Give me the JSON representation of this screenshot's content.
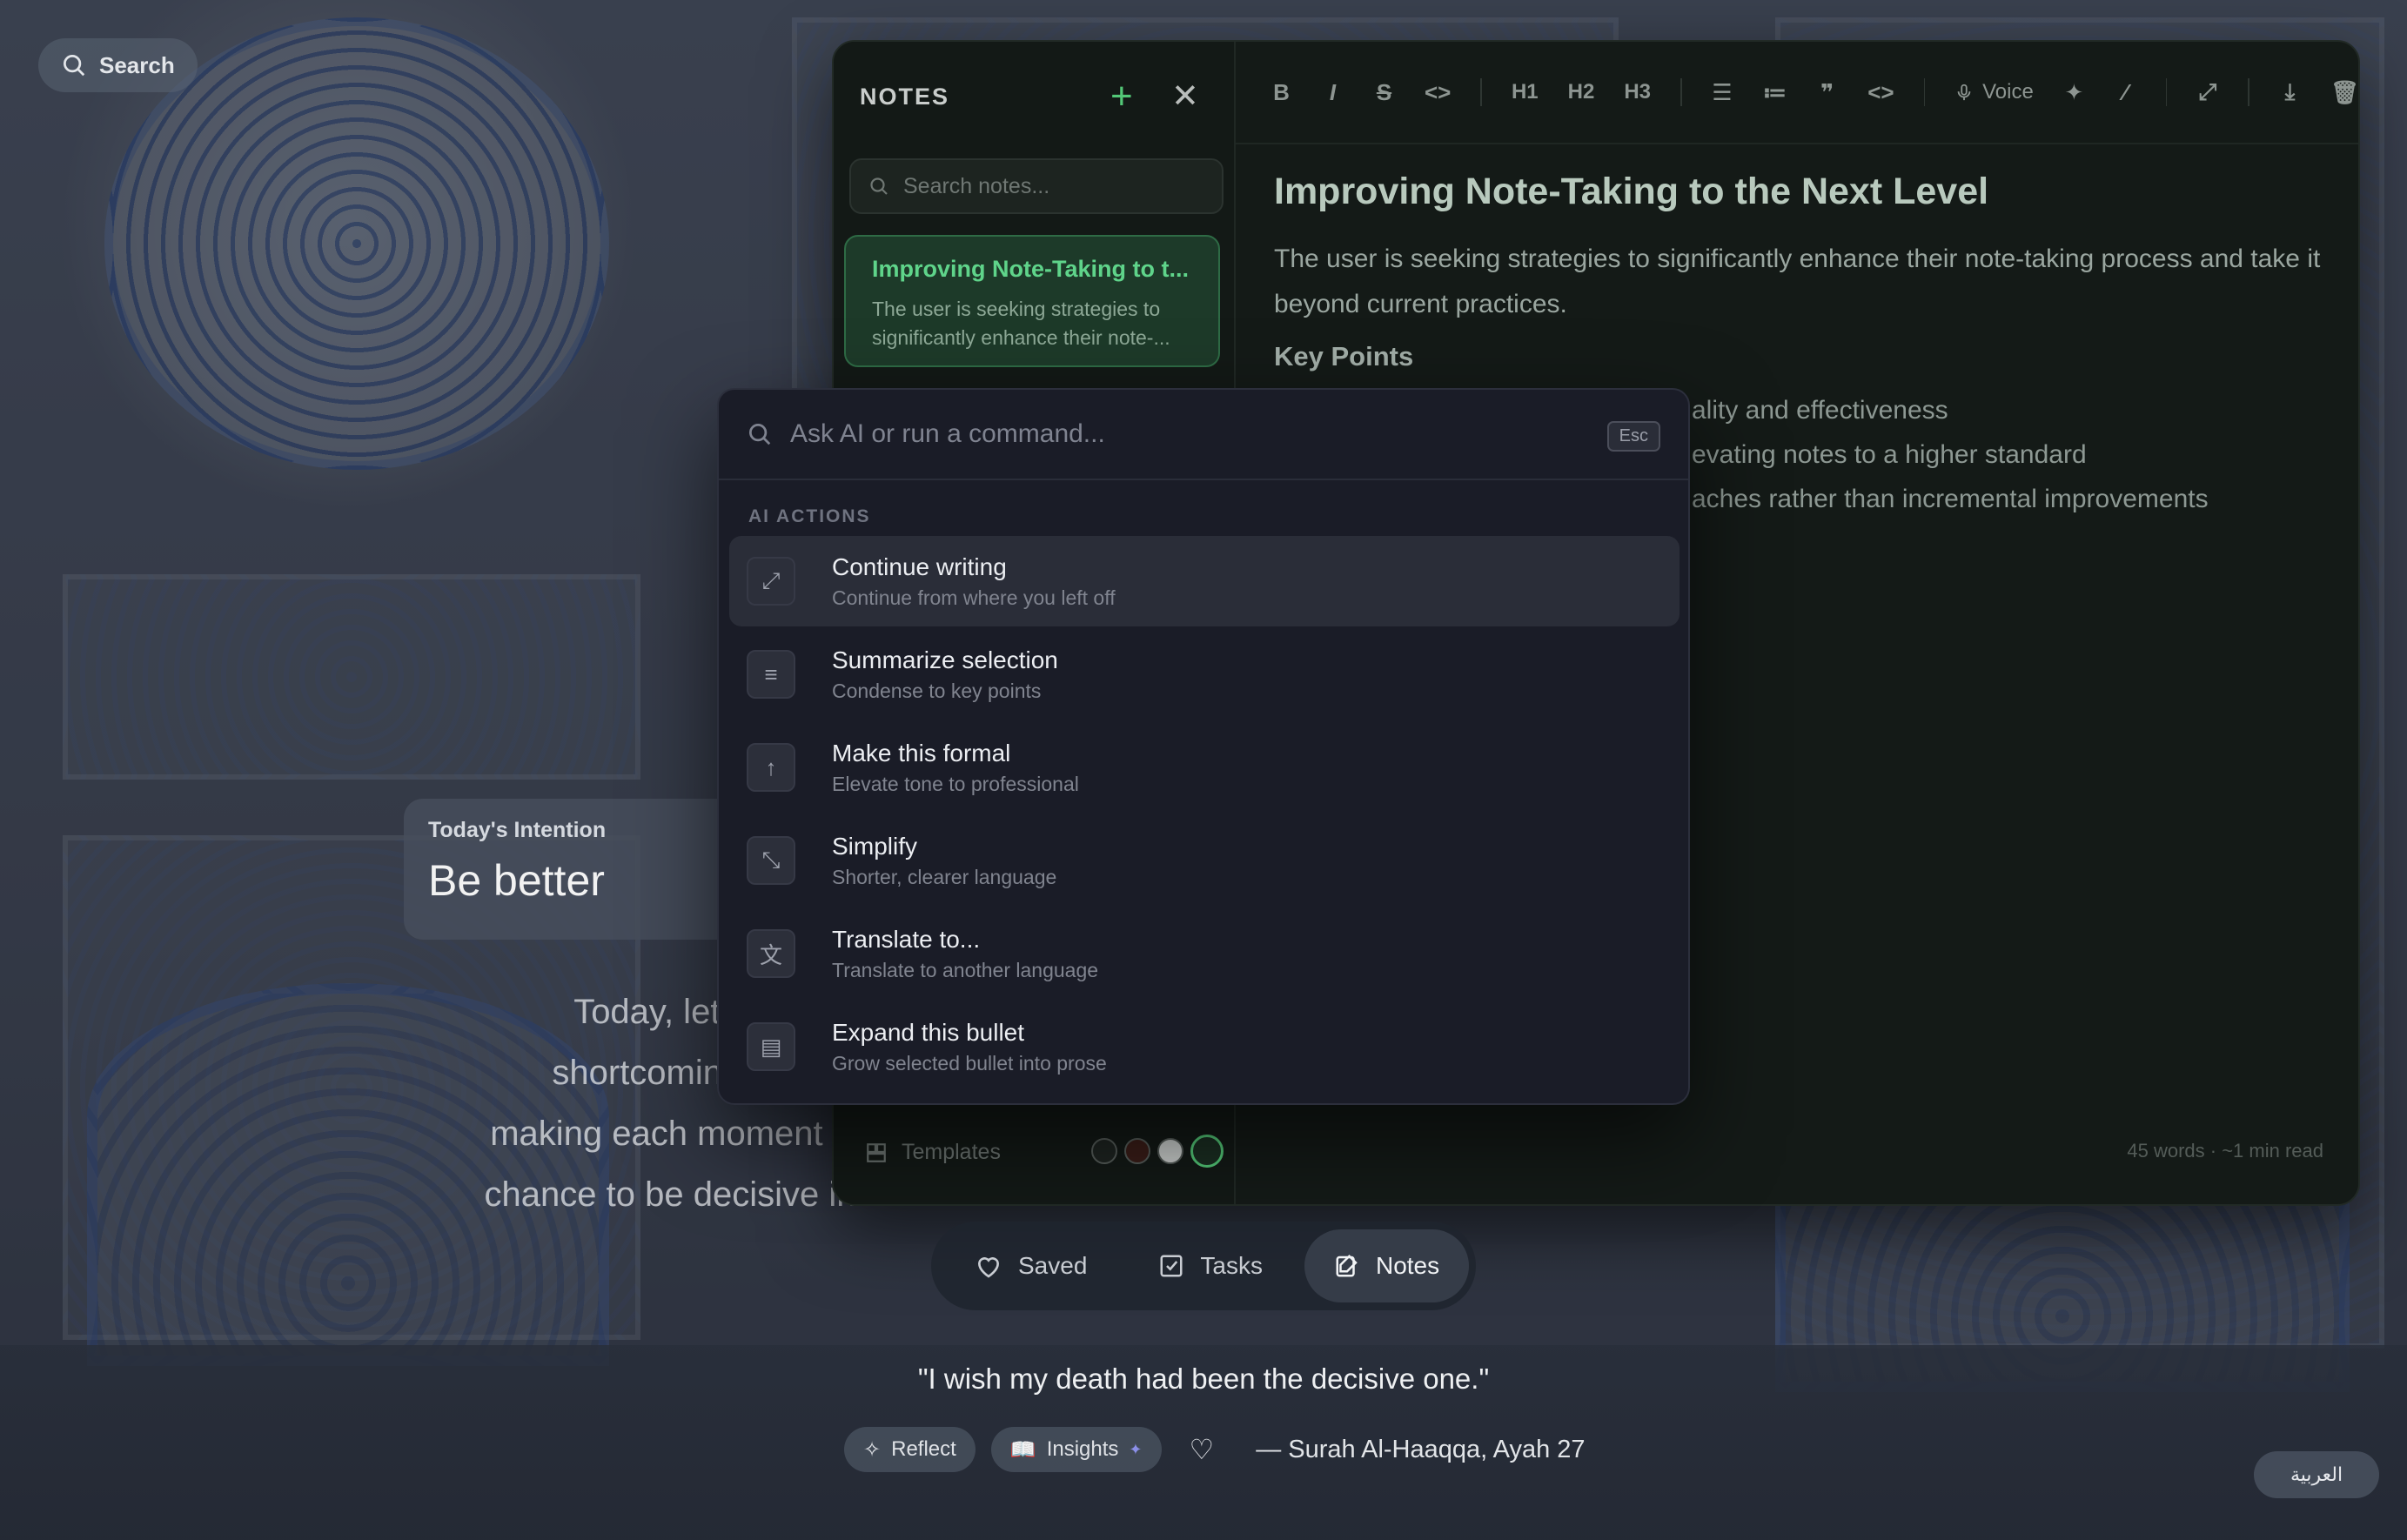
{
  "search_chip": {
    "label": "Search",
    "icon": "search-icon"
  },
  "intention": {
    "label": "Today's Intention",
    "value": "Be better"
  },
  "reflection_text": {
    "lines": [
      "Today, let thi",
      "shortcomings a",
      "making each moment c",
      "chance to be decisive in"
    ]
  },
  "notes": {
    "sidebar_title": "NOTES",
    "search_placeholder": "Search notes...",
    "items": [
      {
        "title": "Improving Note-Taking to t...",
        "snippet": "The user is seeking strategies to significantly enhance their note-..."
      }
    ],
    "footer_templates": "Templates",
    "color_dots": [
      "#1e2421",
      "#3a1d18",
      "#c9cdcb",
      "#1b2e22"
    ]
  },
  "toolbar": {
    "buttons": [
      "B",
      "I",
      "S",
      "<>",
      "H1",
      "H2",
      "H3",
      "bullet-list",
      "numbered-list",
      "quote",
      "code",
      "Voice",
      "sparkle",
      "magic-wand",
      "expand",
      "download",
      "trash"
    ],
    "voice_label": "Voice"
  },
  "editor": {
    "title": "Improving Note-Taking to the Next Level",
    "paragraph": "The user is seeking strategies to significantly enhance their note-taking process and take it beyond current practices.",
    "heading": "Key Points",
    "bullets": [
      "ality and effectiveness",
      "evating notes to a higher standard",
      "aches rather than incremental improvements"
    ],
    "footer": "45 words · ~1 min read"
  },
  "command_palette": {
    "placeholder": "Ask AI or run a command...",
    "esc_label": "Esc",
    "section_label": "AI ACTIONS",
    "items": [
      {
        "title": "Continue writing",
        "subtitle": "Continue from where you left off",
        "icon": "expand-arrows-icon",
        "active": true
      },
      {
        "title": "Summarize selection",
        "subtitle": "Condense to key points",
        "icon": "lines-icon",
        "active": false
      },
      {
        "title": "Make this formal",
        "subtitle": "Elevate tone to professional",
        "icon": "arrow-up-icon",
        "active": false
      },
      {
        "title": "Simplify",
        "subtitle": "Shorter, clearer language",
        "icon": "collapse-arrows-icon",
        "active": false
      },
      {
        "title": "Translate to...",
        "subtitle": "Translate to another language",
        "icon": "translate-icon",
        "active": false
      },
      {
        "title": "Expand this bullet",
        "subtitle": "Grow selected bullet into prose",
        "icon": "document-icon",
        "active": false
      }
    ]
  },
  "tabs": [
    {
      "label": "Saved",
      "icon": "heart-icon",
      "active": false
    },
    {
      "label": "Tasks",
      "icon": "checkbox-icon",
      "active": false
    },
    {
      "label": "Notes",
      "icon": "notes-edit-icon",
      "active": true
    }
  ],
  "quote": {
    "text": "\"I wish my death had been the decisive one.\"",
    "reflect_label": "Reflect",
    "insights_label": "Insights",
    "reference": "— Surah Al-Haaqqa, Ayah 27",
    "language_button": "العربية"
  },
  "colors": {
    "accent_green": "#53c777",
    "panel_bg": "#141a17",
    "palette_bg": "#1a1c27"
  }
}
